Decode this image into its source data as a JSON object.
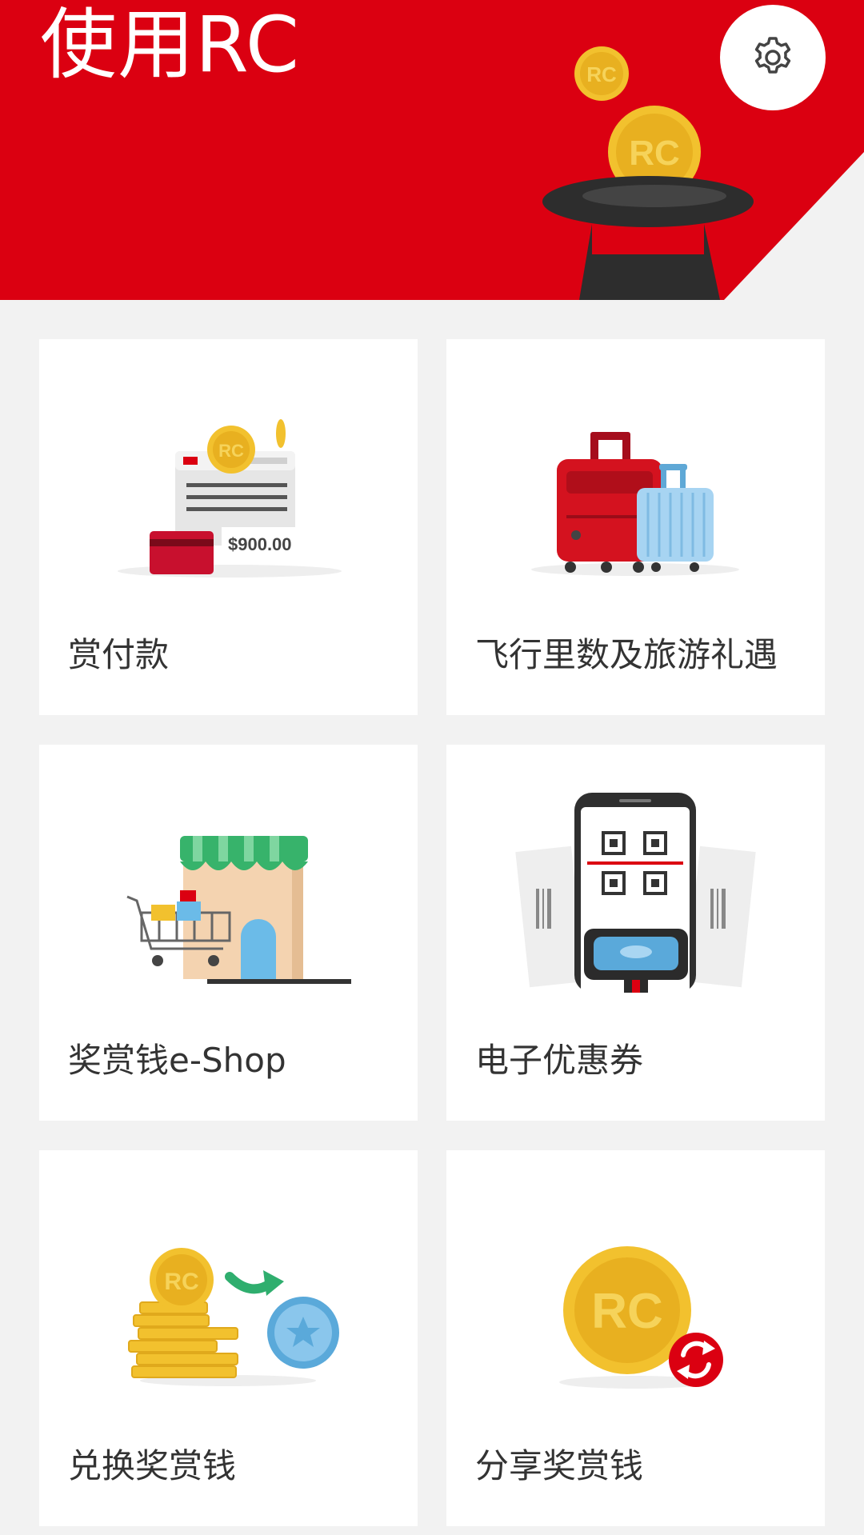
{
  "header": {
    "title": "使用RC",
    "background_color": "#db0011",
    "settings_icon": "gear-icon",
    "coin_text": "RC"
  },
  "cards": [
    {
      "label": "赏付款",
      "icon": "payment-card-icon",
      "amount": "$900.00",
      "coin_text": "RC"
    },
    {
      "label": "飞行里数及旅游礼遇",
      "icon": "luggage-icon"
    },
    {
      "label": "奖赏钱e-Shop",
      "icon": "shop-cart-icon"
    },
    {
      "label": "电子优惠券",
      "icon": "qr-scan-icon"
    },
    {
      "label": "兑换奖赏钱",
      "icon": "coin-exchange-icon",
      "coin_text": "RC"
    },
    {
      "label": "分享奖赏钱",
      "icon": "coin-share-icon",
      "coin_text": "RC"
    }
  ],
  "colors": {
    "brand_red": "#db0011",
    "coin_gold": "#f2c12e",
    "page_bg": "#f2f2f2"
  }
}
